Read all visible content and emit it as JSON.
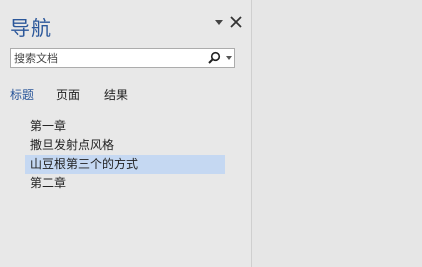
{
  "nav_pane": {
    "title": "导航",
    "search": {
      "placeholder": "搜索文档",
      "icon": "search-icon"
    },
    "tabs": [
      {
        "label": "标题",
        "active": true
      },
      {
        "label": "页面",
        "active": false
      },
      {
        "label": "结果",
        "active": false
      }
    ],
    "headings": [
      {
        "label": "第一章",
        "selected": false
      },
      {
        "label": "撒旦发射点风格",
        "selected": false
      },
      {
        "label": "山豆根第三个的方式",
        "selected": true
      },
      {
        "label": "第二章",
        "selected": false
      }
    ]
  },
  "colors": {
    "accent": "#2b579a",
    "selected_bg": "#c5d8f2",
    "pane_bg": "#e8e8e8"
  }
}
